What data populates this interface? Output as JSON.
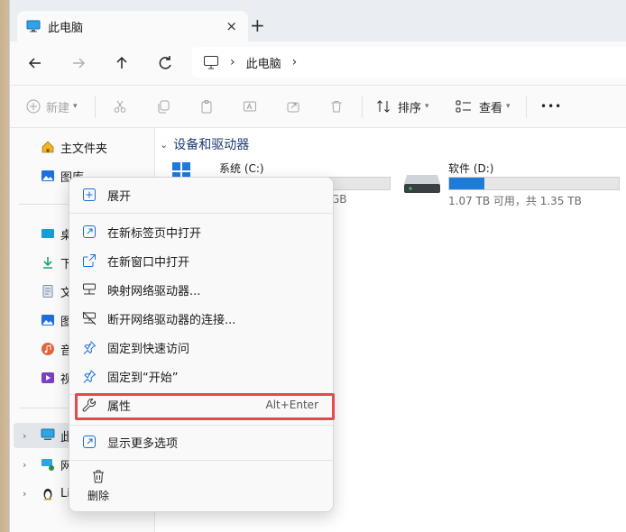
{
  "tab": {
    "title": "此电脑",
    "close_icon": "×",
    "new_tab_icon": "+"
  },
  "nav": {
    "address_segment": "此电脑"
  },
  "commands": {
    "new_label": "新建",
    "sort_label": "排序",
    "view_label": "查看",
    "more_icon": "•••"
  },
  "sidebar": {
    "items": [
      {
        "label": "主文件夹"
      },
      {
        "label": "图库"
      },
      {
        "label": "桌"
      },
      {
        "label": "下"
      },
      {
        "label": "文"
      },
      {
        "label": "图"
      },
      {
        "label": "音"
      },
      {
        "label": "视"
      },
      {
        "label": "此"
      },
      {
        "label": "网"
      },
      {
        "label": "Li"
      }
    ]
  },
  "content": {
    "section_title": "设备和驱动器",
    "drives": [
      {
        "name": "系统 (C:)",
        "info": "GB",
        "used_fraction": 0.0
      },
      {
        "name": "软件 (D:)",
        "info": "1.07 TB 可用，共 1.35 TB",
        "used_fraction": 0.21
      }
    ]
  },
  "menu": {
    "items": [
      {
        "label": "展开"
      },
      {
        "label": "在新标签页中打开"
      },
      {
        "label": "在新窗口中打开"
      },
      {
        "label": "映射网络驱动器..."
      },
      {
        "label": "断开网络驱动器的连接..."
      },
      {
        "label": "固定到快速访问"
      },
      {
        "label": "固定到“开始”"
      },
      {
        "label": "属性",
        "shortcut": "Alt+Enter"
      },
      {
        "label": "显示更多选项"
      }
    ],
    "delete_label": "删除"
  },
  "colors": {
    "accent": "#1e7bd8",
    "highlight_border": "#e5484d"
  }
}
